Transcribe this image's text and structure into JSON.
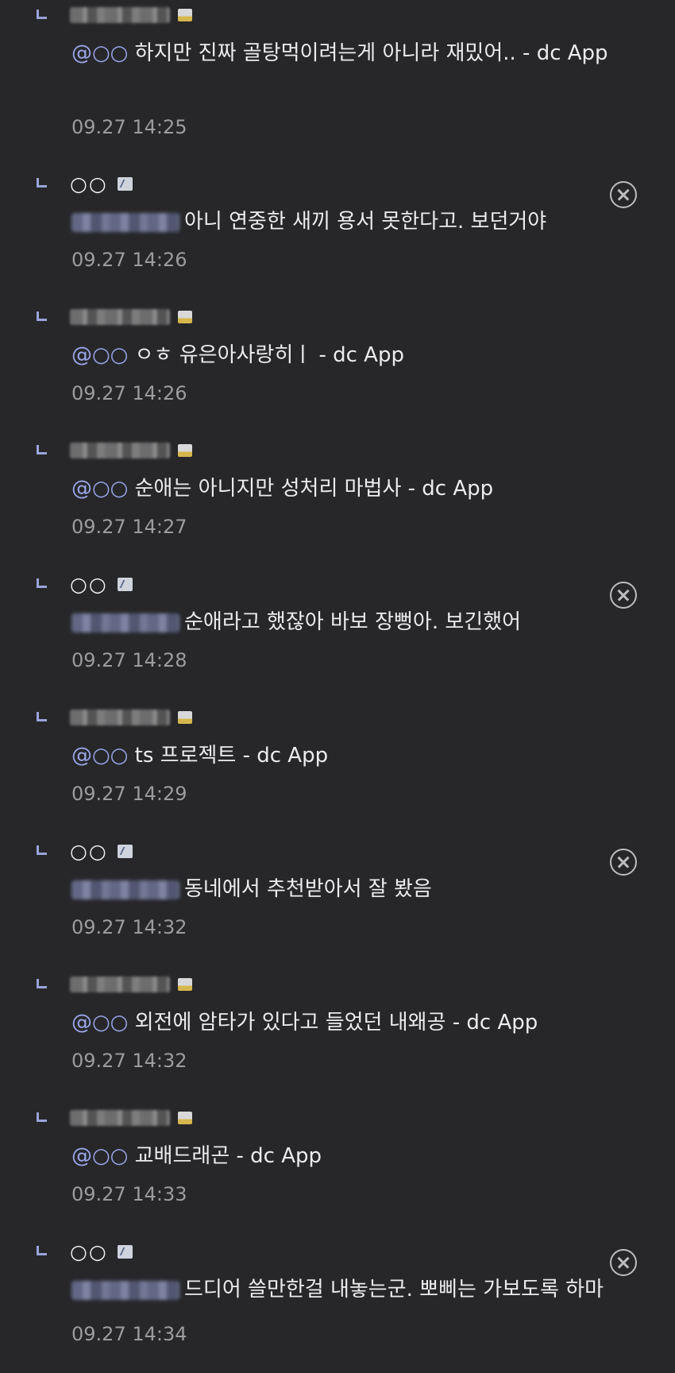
{
  "comments": [
    {
      "author": "",
      "mention": "@○○",
      "text": " 하지만 진짜 골탕먹이려는게 아니라 재밌어.. - dc App",
      "time": "09.27 14:25",
      "own": false
    },
    {
      "author": "○○",
      "mention": "",
      "text": "아니 연중한 새끼 용서 못한다고. 보던거야",
      "time": "09.27 14:26",
      "own": true
    },
    {
      "author": "",
      "mention": "@○○",
      "text": " ㅇㅎ 유은아사랑히ㅣ - dc App",
      "time": "09.27 14:26",
      "own": false
    },
    {
      "author": "",
      "mention": "@○○",
      "text": " 순애는 아니지만 성처리 마법사 - dc App",
      "time": "09.27 14:27",
      "own": false
    },
    {
      "author": "○○",
      "mention": "",
      "text": "순애라고 했잖아 바보 장뻥아. 보긴했어",
      "time": "09.27 14:28",
      "own": true
    },
    {
      "author": "",
      "mention": "@○○",
      "text": " ts 프로젝트 - dc App",
      "time": "09.27 14:29",
      "own": false
    },
    {
      "author": "○○",
      "mention": "",
      "text": "동네에서 추천받아서 잘 봤음",
      "time": "09.27 14:32",
      "own": true
    },
    {
      "author": "",
      "mention": "@○○",
      "text": " 외전에 암타가 있다고 들었던 내왜공 - dc App",
      "time": "09.27 14:32",
      "own": false
    },
    {
      "author": "",
      "mention": "@○○",
      "text": " 교배드래곤 - dc App",
      "time": "09.27 14:33",
      "own": false
    },
    {
      "author": "○○",
      "mention": "",
      "text": "드디어 쓸만한걸 내놓는군. 뽀삐는 가보도록 하마",
      "time": "09.27 14:34",
      "own": true
    }
  ],
  "icons": {
    "reply": "reply-arrow-icon",
    "delete": "delete-circle-x-icon",
    "badge": "user-badge-icon"
  },
  "colors": {
    "background": "#27272a",
    "mention": "#9aa6e8",
    "reply_arrow": "#9aa3d9",
    "timestamp": "#9c9c9c"
  }
}
